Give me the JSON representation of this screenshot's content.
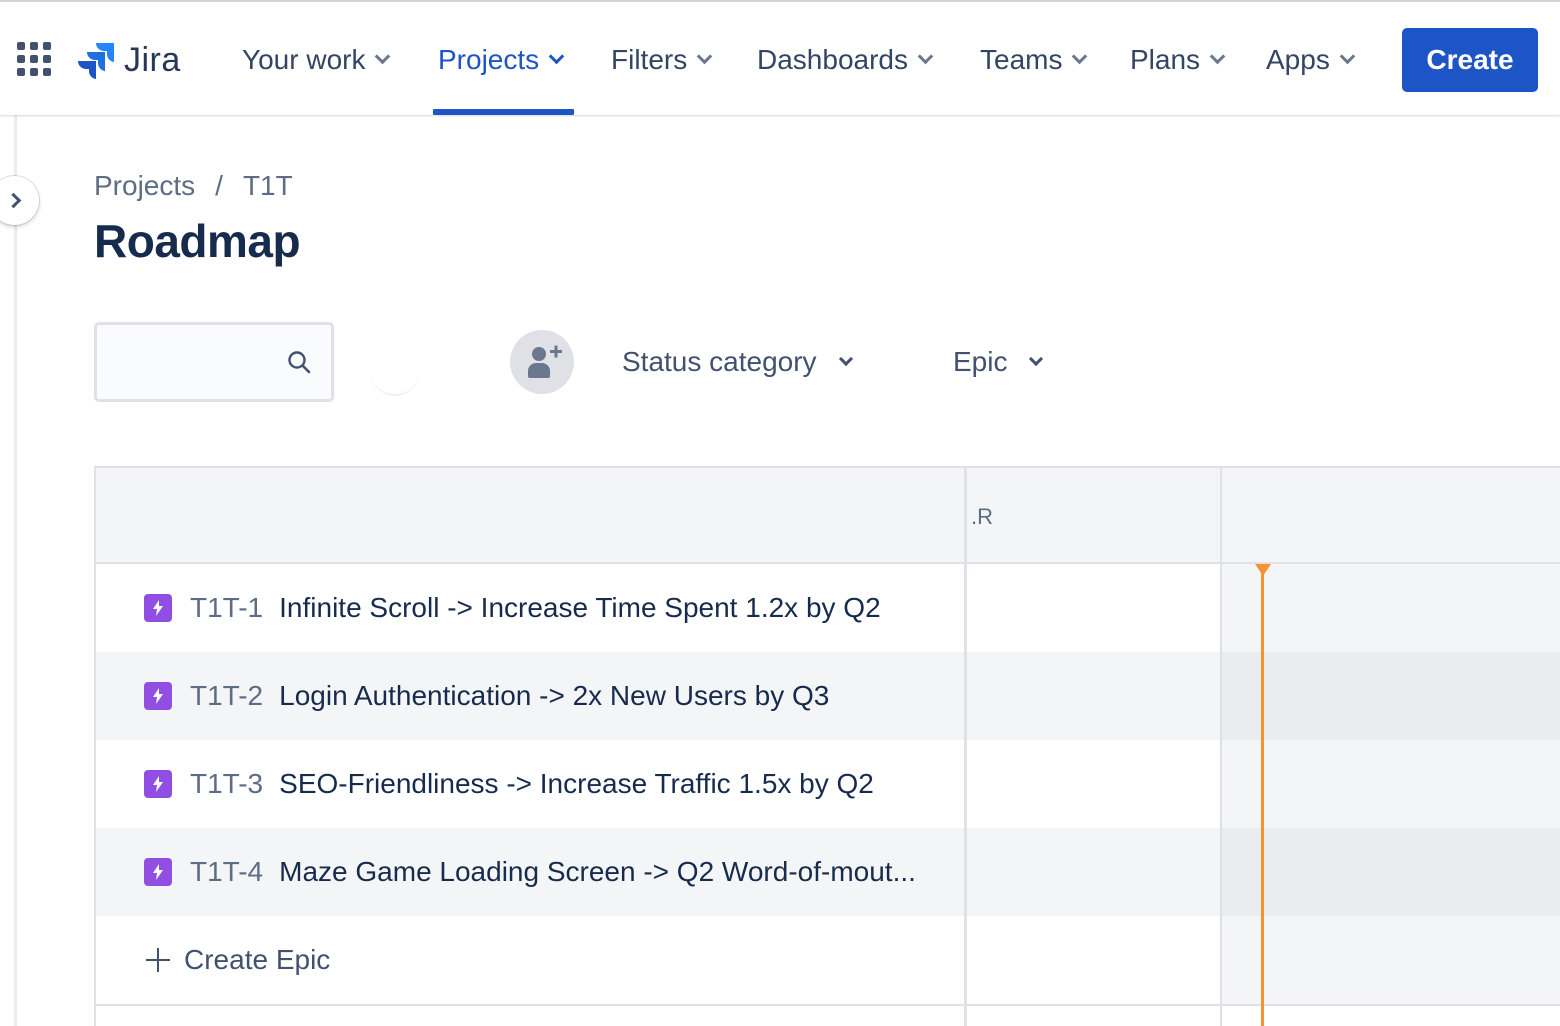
{
  "app": {
    "name": "Jira"
  },
  "nav": {
    "items": [
      {
        "label": "Your work"
      },
      {
        "label": "Projects",
        "active": true
      },
      {
        "label": "Filters"
      },
      {
        "label": "Dashboards"
      },
      {
        "label": "Teams"
      },
      {
        "label": "Plans"
      },
      {
        "label": "Apps"
      }
    ],
    "create_label": "Create"
  },
  "breadcrumb": {
    "items": [
      "Projects",
      "T1T"
    ],
    "separator": "/"
  },
  "page": {
    "title": "Roadmap"
  },
  "filters": {
    "search_placeholder": "",
    "status_category_label": "Status category",
    "epic_label": "Epic"
  },
  "roadmap": {
    "timeline_header_label": ".R",
    "epics": [
      {
        "key": "T1T-1",
        "summary": "Infinite Scroll -> Increase Time Spent 1.2x by Q2"
      },
      {
        "key": "T1T-2",
        "summary": "Login Authentication -> 2x New Users by Q3"
      },
      {
        "key": "T1T-3",
        "summary": "SEO-Friendliness -> Increase Traffic 1.5x by Q2"
      },
      {
        "key": "T1T-4",
        "summary": "Maze Game Loading Screen -> Q2 Word-of-mout..."
      }
    ],
    "create_epic_label": "Create Epic"
  },
  "colors": {
    "brand_blue": "#1d55c7",
    "epic_purple": "#904ee2",
    "today_marker": "#f79233"
  },
  "icons": [
    "app-switcher-icon",
    "jira-logo-icon",
    "search-icon",
    "add-person-icon",
    "lightning-icon",
    "plus-icon",
    "chevron-right-icon"
  ]
}
